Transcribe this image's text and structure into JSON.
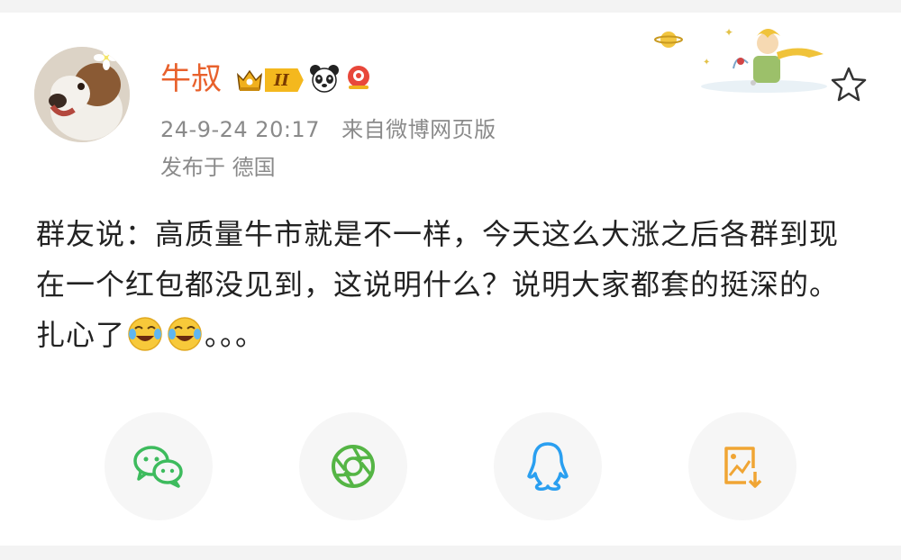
{
  "user": {
    "name": "牛叔",
    "level": "II",
    "badges": [
      "crown-badge",
      "panda-badge",
      "red-badge"
    ]
  },
  "meta": {
    "time": "24-9-24 20:17",
    "source": "来自微博网页版",
    "location": "发布于 德国"
  },
  "post": {
    "text": "群友说：高质量牛市就是不一样，今天这么大涨之后各群到现在一个红包都没见到，这说明什么？说明大家都套的挺深的。扎心了",
    "trailing": "。。。"
  },
  "share": {
    "buttons": [
      "wechat-icon",
      "moments-icon",
      "qq-icon",
      "save-image-icon"
    ]
  },
  "colors": {
    "username": "#e8612c",
    "meta": "#8a8a8a",
    "text": "#222222",
    "wechat": "#3dbb5d",
    "moments": "#55b545",
    "qq": "#2a9ff0",
    "save": "#f0a534"
  }
}
